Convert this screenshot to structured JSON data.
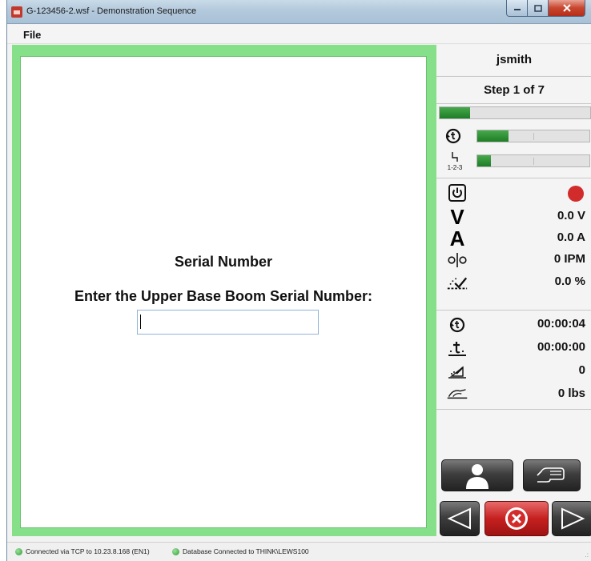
{
  "window": {
    "title": "G-123456-2.wsf - Demonstration Sequence",
    "minimize_icon": "minimize-icon",
    "maximize_icon": "maximize-icon",
    "close_icon": "close-icon"
  },
  "menu": {
    "file_label": "File"
  },
  "main": {
    "title": "Serial Number",
    "prompt": "Enter the Upper Base Boom Serial Number:",
    "serial_input": {
      "value": "",
      "placeholder": ""
    },
    "border_color": "#86e08a"
  },
  "panel": {
    "user": "jsmith",
    "step_label": "Step 1 of 7",
    "progress": {
      "overall": 0.2,
      "time_progress": 0.28,
      "sequence_progress": 0.12,
      "time_icon": "timer-icon",
      "sequence_icon": "sequence-123-icon",
      "sequence_icon_text": "1-2-3"
    },
    "readings": {
      "power_icon": "power-icon",
      "status_color": "#d22b2b",
      "voltage_symbol": "V",
      "voltage": "0.0 V",
      "current_symbol": "A",
      "current": "0.0 A",
      "wire_feed_icon": "wire-feed-icon",
      "wire_feed": "0 IPM",
      "percent_icon": "arc-percent-icon",
      "percent": "0.0 %"
    },
    "timers": {
      "elapsed_icon": "timer-icon",
      "elapsed": "00:00:04",
      "arc_time_icon": "arc-time-icon",
      "arc_time": "00:00:00",
      "weld_count_icon": "weld-count-icon",
      "weld_count": "0",
      "wire_weight_icon": "wire-weight-icon",
      "wire_weight": "0 lbs"
    },
    "buttons": {
      "operator_icon": "operator-icon",
      "manual_icon": "hand-icon",
      "prev_icon": "triangle-left-icon",
      "cancel_icon": "cancel-x-icon",
      "next_icon": "triangle-right-icon"
    }
  },
  "status": {
    "connection": "Connected via TCP to 10.23.8.168 (EN1)",
    "database": "Database Connected to THINK\\LEWS100",
    "ok_color": "#2e9a34"
  }
}
